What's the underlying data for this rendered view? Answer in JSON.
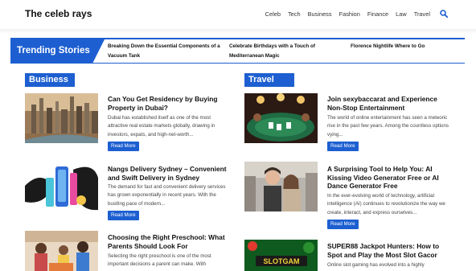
{
  "site": {
    "title": "The celeb rays"
  },
  "nav": {
    "items": [
      "Celeb",
      "Tech",
      "Business",
      "Fashion",
      "Finance",
      "Law",
      "Travel"
    ]
  },
  "trending": {
    "label": "Trending Stories",
    "stories": [
      "Breaking Down the Essential Components of a Vacuum Tank",
      "Celebrate Birthdays with a Touch of Mediterranean Magic",
      "Florence Nightlife Where to Go"
    ]
  },
  "business": {
    "heading": "Business",
    "cards": [
      {
        "title": "Can You Get Residency by Buying Property in Dubai?",
        "excerpt": "Dubai has established itself as one of the most attractive real estate markets globally, drawing in investors, expats, and high-net-worth...",
        "button": "Read More"
      },
      {
        "title": "Nangs Delivery Sydney – Convenient and Swift Delivery in Sydney",
        "excerpt": "The demand for fast and convenient delivery services has grown exponentially in recent years. With the bustling pace of modern...",
        "button": "Read More"
      },
      {
        "title": "Choosing the Right Preschool: What Parents Should Look For",
        "excerpt": "Selecting the right preschool is one of the most important decisions a parent can make. With"
      }
    ]
  },
  "travel": {
    "heading": "Travel",
    "cards": [
      {
        "title": "Join sexybaccarat and Experience Non-Stop Entertainment",
        "excerpt": "The world of online entertainment has seen a meteoric rise in the past few years. Among the countless options vying...",
        "button": "Read More"
      },
      {
        "title": "A Surprising Tool to Help You: AI Kissing Video Generator Free or AI Dance Generator Free",
        "excerpt": "In the ever-evolving world of technology, artificial intelligence (AI) continues to revolutionize the way we create, interact, and express ourselves...",
        "button": "Read More"
      },
      {
        "title": "SUPER88 Jackpot Hunters: How to Spot and Play the Most Slot Gacor",
        "excerpt": "Online slot gaming has evolved into a highly",
        "image_text": "SLOTGAM"
      }
    ]
  },
  "colors": {
    "accent": "#1d5fd1",
    "text": "#111111"
  },
  "icons": {
    "search": "search-icon"
  }
}
